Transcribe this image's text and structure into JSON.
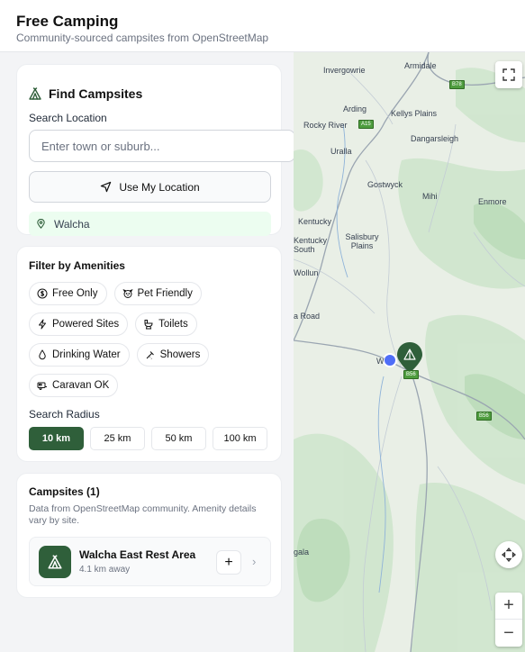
{
  "header": {
    "title": "Free Camping",
    "subtitle": "Community-sourced campsites from OpenStreetMap"
  },
  "find": {
    "title": "Find Campsites",
    "search_label": "Search Location",
    "search_placeholder": "Enter town or suburb...",
    "use_location": "Use My Location",
    "current_location": "Walcha"
  },
  "filter": {
    "title": "Filter by Amenities",
    "amenities": [
      {
        "label": "Free Only",
        "icon": "dollar-icon"
      },
      {
        "label": "Pet Friendly",
        "icon": "dog-icon"
      },
      {
        "label": "Powered Sites",
        "icon": "lightning-icon"
      },
      {
        "label": "Toilets",
        "icon": "toilet-icon"
      },
      {
        "label": "Drinking Water",
        "icon": "water-drop-icon"
      },
      {
        "label": "Showers",
        "icon": "shower-icon"
      },
      {
        "label": "Caravan OK",
        "icon": "caravan-icon"
      }
    ],
    "radius_label": "Search Radius",
    "radius_options": [
      "10 km",
      "25 km",
      "50 km",
      "100 km"
    ],
    "radius_selected": "10 km"
  },
  "sites": {
    "title": "Campsites (1)",
    "note": "Data from OpenStreetMap community. Amenity details vary by site.",
    "items": [
      {
        "name": "Walcha East Rest Area",
        "distance": "4.1 km away"
      }
    ]
  },
  "map": {
    "places": [
      "Invergowrie",
      "Armidale",
      "Arding",
      "Kellys Plains",
      "Rocky River",
      "Dangarsleigh",
      "Uralla",
      "Gostwyck",
      "Mihi",
      "Enmore",
      "Kentucky",
      "Kentucky South",
      "Salisbury Plains",
      "Wollun",
      "a Road",
      "W",
      "gala"
    ],
    "road_shields": [
      "B78",
      "A15",
      "B56",
      "B56"
    ],
    "controls": {
      "zoom_in": "+",
      "zoom_out": "−"
    }
  },
  "colors": {
    "accent": "#2f5f3a",
    "location_bg": "#ecfdf0",
    "user_dot": "#4f6ef7"
  }
}
